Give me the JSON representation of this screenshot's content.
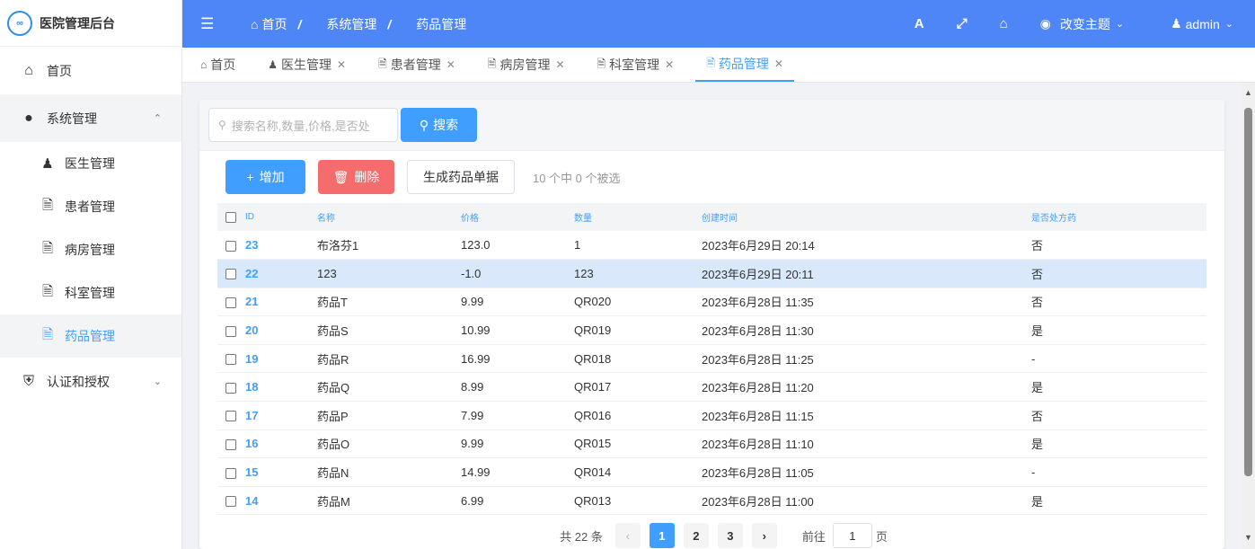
{
  "app": {
    "title": "医院管理后台",
    "logo_text": "∞"
  },
  "sidebar": {
    "home_label": "首页",
    "system_label": "系统管理",
    "system_items": [
      {
        "label": "医生管理"
      },
      {
        "label": "患者管理"
      },
      {
        "label": "病房管理"
      },
      {
        "label": "科室管理"
      },
      {
        "label": "药品管理"
      }
    ],
    "auth_label": "认证和授权"
  },
  "header": {
    "breadcrumb": [
      "首页",
      "系统管理",
      "药品管理"
    ],
    "font_btn": "A",
    "theme_label": "改变主题",
    "user_label": "admin"
  },
  "tabs": [
    {
      "label": "首页"
    },
    {
      "label": "医生管理"
    },
    {
      "label": "患者管理"
    },
    {
      "label": "病房管理"
    },
    {
      "label": "科室管理"
    },
    {
      "label": "药品管理"
    }
  ],
  "search": {
    "placeholder": "搜索名称,数量,价格,是否处",
    "button": "搜索"
  },
  "toolbar": {
    "add": "增加",
    "delete": "删除",
    "generate": "生成药品单据",
    "selection": "10 个中 0 个被选"
  },
  "table": {
    "columns": [
      "ID",
      "名称",
      "价格",
      "数量",
      "创建时间",
      "是否处方药"
    ],
    "rows": [
      {
        "id": "23",
        "name": "布洛芬1",
        "price": "123.0",
        "qty": "1",
        "created": "2023年6月29日 20:14",
        "rx": "否"
      },
      {
        "id": "22",
        "name": "123",
        "price": "-1.0",
        "qty": "123",
        "created": "2023年6月29日 20:11",
        "rx": "否"
      },
      {
        "id": "21",
        "name": "药品T",
        "price": "9.99",
        "qty": "QR020",
        "created": "2023年6月28日 11:35",
        "rx": "否"
      },
      {
        "id": "20",
        "name": "药品S",
        "price": "10.99",
        "qty": "QR019",
        "created": "2023年6月28日 11:30",
        "rx": "是"
      },
      {
        "id": "19",
        "name": "药品R",
        "price": "16.99",
        "qty": "QR018",
        "created": "2023年6月28日 11:25",
        "rx": "-"
      },
      {
        "id": "18",
        "name": "药品Q",
        "price": "8.99",
        "qty": "QR017",
        "created": "2023年6月28日 11:20",
        "rx": "是"
      },
      {
        "id": "17",
        "name": "药品P",
        "price": "7.99",
        "qty": "QR016",
        "created": "2023年6月28日 11:15",
        "rx": "否"
      },
      {
        "id": "16",
        "name": "药品O",
        "price": "9.99",
        "qty": "QR015",
        "created": "2023年6月28日 11:10",
        "rx": "是"
      },
      {
        "id": "15",
        "name": "药品N",
        "price": "14.99",
        "qty": "QR014",
        "created": "2023年6月28日 11:05",
        "rx": "-"
      },
      {
        "id": "14",
        "name": "药品M",
        "price": "6.99",
        "qty": "QR013",
        "created": "2023年6月28日 11:00",
        "rx": "是"
      }
    ]
  },
  "pagination": {
    "total": "共 22 条",
    "pages": [
      "1",
      "2",
      "3"
    ],
    "current": "1",
    "goto_label": "前往",
    "goto_value": "1",
    "page_suffix": "页"
  },
  "colors": {
    "header": "#4f86f7",
    "accent": "#409eff",
    "danger": "#f56c6c"
  }
}
